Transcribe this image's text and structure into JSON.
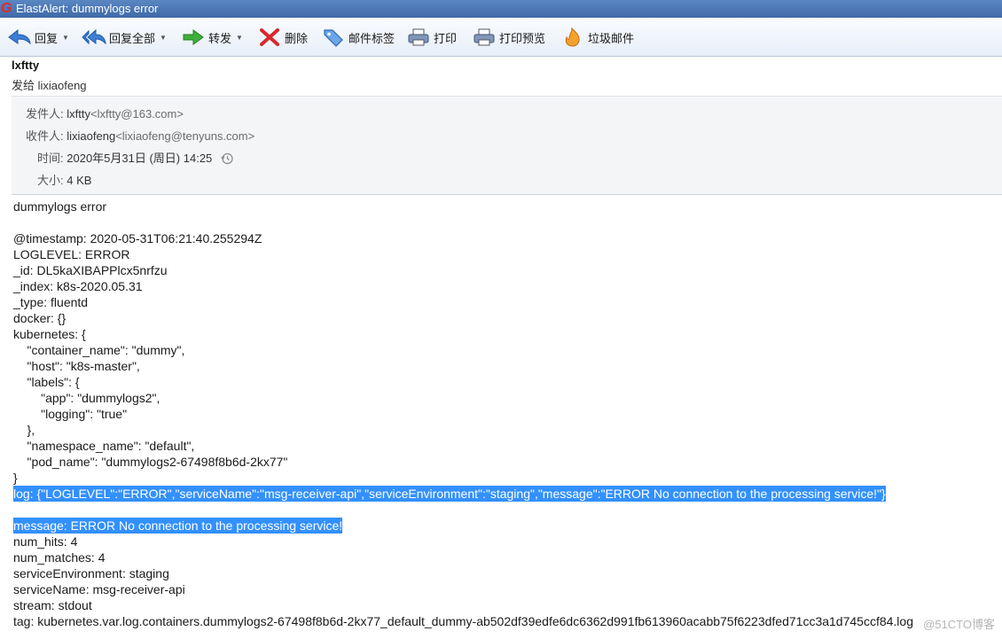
{
  "window": {
    "title": "ElastAlert: dummylogs error",
    "logo": "G"
  },
  "toolbar": {
    "reply": "回复",
    "reply_all": "回复全部",
    "forward": "转发",
    "delete": "删除",
    "tag": "邮件标签",
    "print": "打印",
    "print_preview": "打印预览",
    "junk": "垃圾邮件"
  },
  "header": {
    "sender_name": "lxftty",
    "sent_to": "发给 lixiaofeng"
  },
  "meta": {
    "from_label": "发件人:",
    "from_name": "lxftty",
    "from_addr": "<lxftty@163.com>",
    "to_label": "收件人:",
    "to_name": "lixiaofeng",
    "to_addr": "<lixiaofeng@tenyuns.com>",
    "time_label": "时间:",
    "time_value": "2020年5月31日 (周日) 14:25",
    "size_label": "大小:",
    "size_value": "4 KB"
  },
  "body": {
    "lines": [
      "dummylogs error",
      "",
      "@timestamp: 2020-05-31T06:21:40.255294Z",
      "LOGLEVEL: ERROR",
      "_id: DL5kaXIBAPPlcx5nrfzu",
      "_index: k8s-2020.05.31",
      "_type: fluentd",
      "docker: {}",
      "kubernetes: {",
      "    \"container_name\": \"dummy\",",
      "    \"host\": \"k8s-master\",",
      "    \"labels\": {",
      "        \"app\": \"dummylogs2\",",
      "        \"logging\": \"true\"",
      "    },",
      "    \"namespace_name\": \"default\",",
      "    \"pod_name\": \"dummylogs2-67498f8b6d-2kx77\"",
      "}",
      "log: {\"LOGLEVEL\":\"ERROR\",\"serviceName\":\"msg-receiver-api\",\"serviceEnvironment\":\"staging\",\"message\":\"ERROR No connection to the processing service!\"}",
      "",
      "message: ERROR No connection to the processing service!",
      "num_hits: 4",
      "num_matches: 4",
      "serviceEnvironment: staging",
      "serviceName: msg-receiver-api",
      "stream: stdout",
      "tag: kubernetes.var.log.containers.dummylogs2-67498f8b6d-2kx77_default_dummy-ab502df39edfe6dc6362d991fb613960acabb75f6223dfed71cc3a1d745ccf84.log"
    ]
  },
  "watermark": "@51CTO博客",
  "colors": {
    "selection": "#3390ff",
    "titlebar": "#4a77b6"
  }
}
